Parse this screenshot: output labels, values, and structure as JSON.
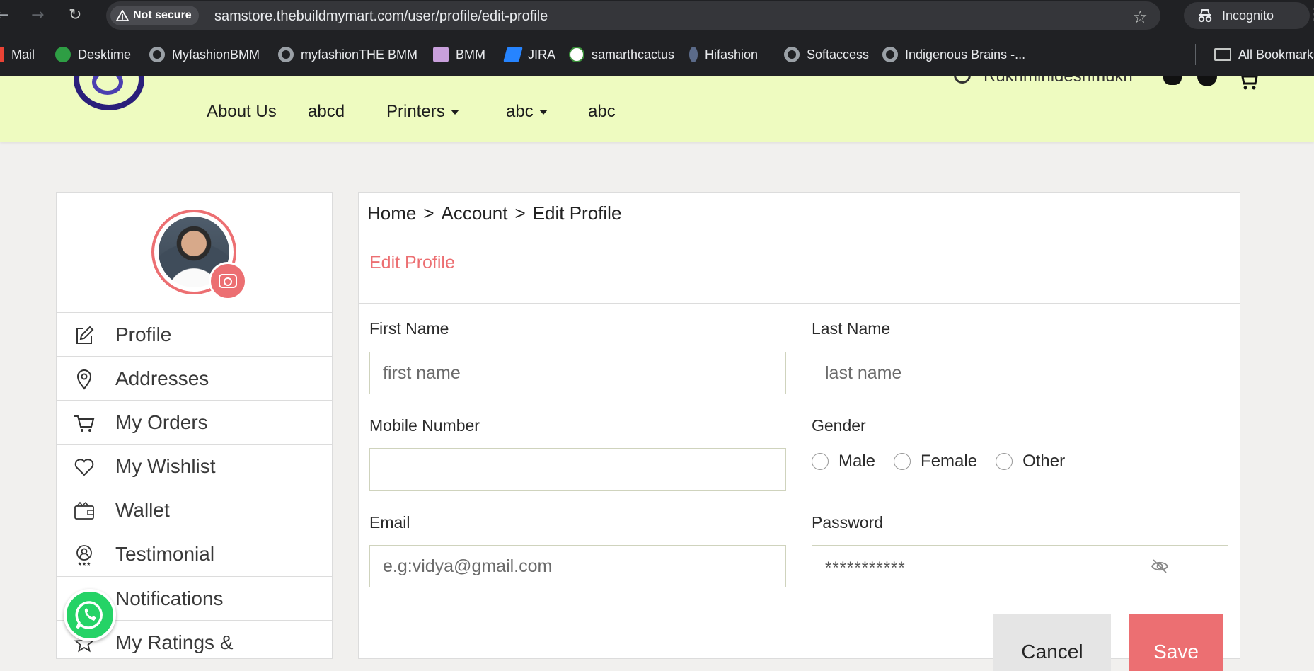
{
  "browser": {
    "security_label": "Not secure",
    "url": "samstore.thebuildmymart.com/user/profile/edit-profile",
    "incognito_label": "Incognito",
    "bookmarks": [
      {
        "label": "Mail",
        "icon": "gmail-icon"
      },
      {
        "label": "Desktime",
        "icon": "desktime-icon"
      },
      {
        "label": "MyfashionBMM",
        "icon": "globe-icon"
      },
      {
        "label": "myfashionTHE BMM",
        "icon": "globe-icon"
      },
      {
        "label": "BMM",
        "icon": "bmm-icon"
      },
      {
        "label": "JIRA",
        "icon": "jira-icon"
      },
      {
        "label": "samarthcactus",
        "icon": "cactus-icon"
      },
      {
        "label": "Hifashion",
        "icon": "hifashion-icon"
      },
      {
        "label": "Softaccess",
        "icon": "globe-icon"
      },
      {
        "label": "Indigenous Brains -...",
        "icon": "globe-icon"
      }
    ],
    "all_bookmarks_label": "All Bookmarks"
  },
  "header": {
    "nav": [
      {
        "label": "About Us",
        "dropdown": false
      },
      {
        "label": "abcd",
        "dropdown": false
      },
      {
        "label": "Printers",
        "dropdown": true
      },
      {
        "label": "abc",
        "dropdown": true
      },
      {
        "label": "abc",
        "dropdown": false
      }
    ],
    "user_name": "Rukhminideshmukh"
  },
  "sidebar": {
    "items": [
      {
        "label": "Profile",
        "icon": "edit-icon"
      },
      {
        "label": "Addresses",
        "icon": "location-pin-icon"
      },
      {
        "label": "My Orders",
        "icon": "cart-icon"
      },
      {
        "label": "My Wishlist",
        "icon": "heart-icon"
      },
      {
        "label": "Wallet",
        "icon": "wallet-icon"
      },
      {
        "label": "Testimonial",
        "icon": "testimonial-icon"
      },
      {
        "label": "Notifications",
        "icon": "bell-icon"
      },
      {
        "label": "My Ratings &",
        "icon": "star-icon"
      }
    ]
  },
  "breadcrumb": {
    "items": [
      "Home",
      "Account",
      "Edit Profile"
    ],
    "separator": ">"
  },
  "form": {
    "title": "Edit Profile",
    "first_name": {
      "label": "First Name",
      "placeholder": "first name",
      "value": ""
    },
    "last_name": {
      "label": "Last Name",
      "placeholder": "last name",
      "value": ""
    },
    "mobile": {
      "label": "Mobile Number",
      "placeholder": "",
      "value": ""
    },
    "gender": {
      "label": "Gender",
      "options": [
        "Male",
        "Female",
        "Other"
      ],
      "selected": null
    },
    "email": {
      "label": "Email",
      "placeholder": "e.g:vidya@gmail.com",
      "value": ""
    },
    "password": {
      "label": "Password",
      "masked_value": "***********"
    },
    "cancel_label": "Cancel",
    "save_label": "Save"
  },
  "colors": {
    "accent": "#ec6f72",
    "header_bg": "#eefbc0",
    "page_bg": "#f1f0ee",
    "whatsapp": "#25d366"
  }
}
